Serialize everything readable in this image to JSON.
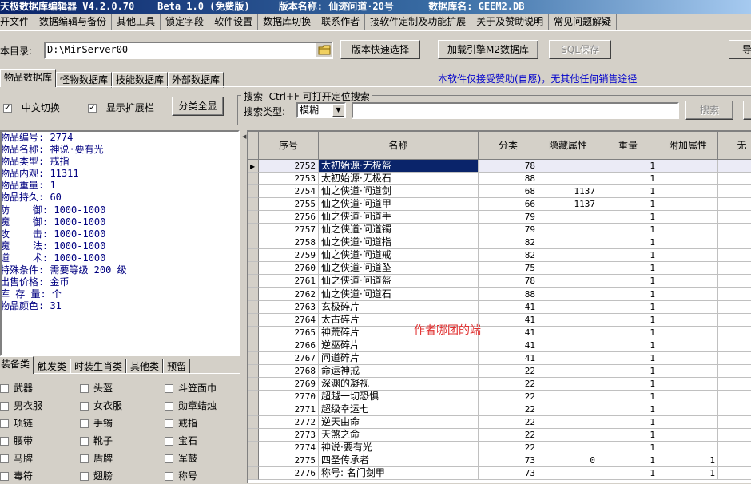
{
  "window": {
    "title": "天极数据库编辑器 V4.2.0.70    Beta 1.0 (免费版)     版本名称: 仙迹问道·20号      数据库名: GEEM2.DB"
  },
  "menu": [
    "开文件",
    "数据编辑与备份",
    "其他工具",
    "锁定字段",
    "软件设置",
    "数据库切换",
    "联系作者",
    "接软件定制及功能扩展",
    "关于及赞助说明",
    "常见问题解疑"
  ],
  "toolbar": {
    "dir_label": "本目录:",
    "dir_value": "D:\\MirServer00",
    "version_select": "版本快速选择",
    "load_engine": "加载引擎M2数据库",
    "sql_save": "SQL保存",
    "import_partial": "导"
  },
  "db_tabs": [
    "物品数据库",
    "怪物数据库",
    "技能数据库",
    "外部数据库"
  ],
  "notice": "本软件仅接受赞助(自愿)，无其他任何销售途径",
  "options": {
    "chinese_switch": "中文切换",
    "chinese_switch_checked": true,
    "show_ext": "显示扩展栏",
    "show_ext_checked": true,
    "show_all": "分类全显"
  },
  "search": {
    "group_label": "搜索  Ctrl+F 可打开定位搜索",
    "type_label": "搜索类型:",
    "type_value": "模糊",
    "query": "",
    "button": "搜索"
  },
  "detail_lines": [
    "物品编号: 2774",
    "物品名称: 神说·要有光",
    "物品类型: 戒指",
    "物品内观: 11311",
    "物品重量: 1",
    "物品持久: 60",
    "防    御: 1000-1000",
    "魔    御: 1000-1000",
    "攻    击: 1000-1000",
    "魔    法: 1000-1000",
    "道    术: 1000-1000",
    "特殊条件: 需要等级 200 级",
    "出售价格: 金币",
    "库 存 量: 个",
    "物品颜色: 31"
  ],
  "category_tabs": [
    "装备类",
    "触发类",
    "时装生肖类",
    "其他类",
    "预留"
  ],
  "categories": [
    {
      "label": "武器",
      "checked": false
    },
    {
      "label": "头盔",
      "checked": false
    },
    {
      "label": "斗笠面巾",
      "checked": false
    },
    {
      "label": "男衣服",
      "checked": false
    },
    {
      "label": "女衣服",
      "checked": false
    },
    {
      "label": "勋章蜡烛",
      "checked": false
    },
    {
      "label": "项链",
      "checked": false
    },
    {
      "label": "手镯",
      "checked": false
    },
    {
      "label": "戒指",
      "checked": false
    },
    {
      "label": "腰带",
      "checked": false
    },
    {
      "label": "靴子",
      "checked": false
    },
    {
      "label": "宝石",
      "checked": false
    },
    {
      "label": "马牌",
      "checked": false
    },
    {
      "label": "盾牌",
      "checked": false
    },
    {
      "label": "军鼓",
      "checked": false
    },
    {
      "label": "毒符",
      "checked": false
    },
    {
      "label": "翅膀",
      "checked": false
    },
    {
      "label": "称号",
      "checked": false
    }
  ],
  "grid": {
    "columns": [
      "序号",
      "名称",
      "分类",
      "隐藏属性",
      "重量",
      "附加属性",
      "无"
    ],
    "watermark": "作者哪团的端",
    "selected_index": 0,
    "rows": [
      {
        "id": "2752",
        "name": "太初始源·无极盔",
        "cat": "78",
        "hidden": "",
        "weight": "1",
        "extra": ""
      },
      {
        "id": "2753",
        "name": "太初始源·无极石",
        "cat": "88",
        "hidden": "",
        "weight": "1",
        "extra": ""
      },
      {
        "id": "2754",
        "name": "仙之侠道·问道剑",
        "cat": "68",
        "hidden": "1137",
        "weight": "1",
        "extra": ""
      },
      {
        "id": "2755",
        "name": "仙之侠道·问道甲",
        "cat": "66",
        "hidden": "1137",
        "weight": "1",
        "extra": ""
      },
      {
        "id": "2756",
        "name": "仙之侠道·问道手",
        "cat": "79",
        "hidden": "",
        "weight": "1",
        "extra": ""
      },
      {
        "id": "2757",
        "name": "仙之侠道·问道镯",
        "cat": "79",
        "hidden": "",
        "weight": "1",
        "extra": ""
      },
      {
        "id": "2758",
        "name": "仙之侠道·问道指",
        "cat": "82",
        "hidden": "",
        "weight": "1",
        "extra": ""
      },
      {
        "id": "2759",
        "name": "仙之侠道·问道戒",
        "cat": "82",
        "hidden": "",
        "weight": "1",
        "extra": ""
      },
      {
        "id": "2760",
        "name": "仙之侠道·问道坠",
        "cat": "75",
        "hidden": "",
        "weight": "1",
        "extra": ""
      },
      {
        "id": "2761",
        "name": "仙之侠道·问道盔",
        "cat": "78",
        "hidden": "",
        "weight": "1",
        "extra": ""
      },
      {
        "id": "2762",
        "name": "仙之侠道·问道石",
        "cat": "88",
        "hidden": "",
        "weight": "1",
        "extra": ""
      },
      {
        "id": "2763",
        "name": "玄极碎片",
        "cat": "41",
        "hidden": "",
        "weight": "1",
        "extra": ""
      },
      {
        "id": "2764",
        "name": "太古碎片",
        "cat": "41",
        "hidden": "",
        "weight": "1",
        "extra": ""
      },
      {
        "id": "2765",
        "name": "神荒碎片",
        "cat": "41",
        "hidden": "",
        "weight": "1",
        "extra": ""
      },
      {
        "id": "2766",
        "name": "逆巫碎片",
        "cat": "41",
        "hidden": "",
        "weight": "1",
        "extra": ""
      },
      {
        "id": "2767",
        "name": "问道碎片",
        "cat": "41",
        "hidden": "",
        "weight": "1",
        "extra": ""
      },
      {
        "id": "2768",
        "name": "命运神戒",
        "cat": "22",
        "hidden": "",
        "weight": "1",
        "extra": ""
      },
      {
        "id": "2769",
        "name": "深渊的凝视",
        "cat": "22",
        "hidden": "",
        "weight": "1",
        "extra": ""
      },
      {
        "id": "2770",
        "name": "超越一切恐惧",
        "cat": "22",
        "hidden": "",
        "weight": "1",
        "extra": ""
      },
      {
        "id": "2771",
        "name": "超级幸运七",
        "cat": "22",
        "hidden": "",
        "weight": "1",
        "extra": ""
      },
      {
        "id": "2772",
        "name": "逆天由命",
        "cat": "22",
        "hidden": "",
        "weight": "1",
        "extra": ""
      },
      {
        "id": "2773",
        "name": "天煞之命",
        "cat": "22",
        "hidden": "",
        "weight": "1",
        "extra": ""
      },
      {
        "id": "2774",
        "name": "神说·要有光",
        "cat": "22",
        "hidden": "",
        "weight": "1",
        "extra": ""
      },
      {
        "id": "2775",
        "name": "四圣传承者",
        "cat": "73",
        "hidden": "0",
        "weight": "1",
        "extra": "1"
      },
      {
        "id": "2776",
        "name": "称号: 名门剑甲",
        "cat": "73",
        "hidden": "",
        "weight": "1",
        "extra": "1"
      }
    ]
  }
}
